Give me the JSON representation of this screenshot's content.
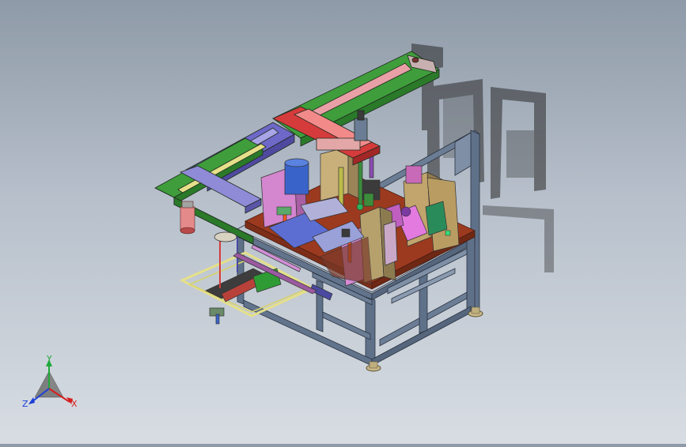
{
  "viewport": {
    "background_top": "#8f9aa8",
    "background_bottom": "#d8dde3"
  },
  "triad": {
    "x_label": "X",
    "y_label": "Y",
    "z_label": "Z",
    "x_color": "#d61f1f",
    "y_color": "#1fa83a",
    "z_color": "#1c3fd6"
  },
  "colors": {
    "frame": "#5f7189",
    "rail_green": "#2f9b35",
    "rail_blue": "#6e68c9",
    "rail_red": "#d63b3b",
    "plate_brown": "#9c3a1f",
    "fixture_tan": "#b9a06a",
    "fixture_pink": "#e08ad6",
    "yellow_frame": "#e5e089"
  }
}
